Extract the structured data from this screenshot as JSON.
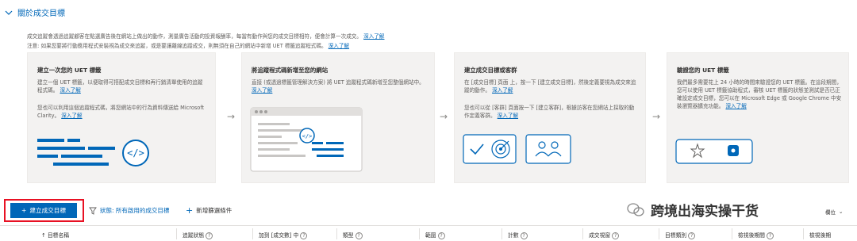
{
  "section": {
    "title": "關於成交目標",
    "desc_line1": "成交追蹤會透過追蹤顧客在點選廣告後在網站上做出的動作，測量廣告活動的投資報酬率，每當有動作與您的成交目標相符，便會計算一次成交。",
    "desc_line1_link": "深入了解",
    "desc_line2": "注意: 如果您要將行動應用程式安裝視為成交來追蹤，或是要讓離線追蹤成交，則無須在自己的網站中新增 UET 標籤追蹤程式碼。",
    "desc_line2_link": "深入了解"
  },
  "cards": [
    {
      "title": "建立一次您的 UET 標籤",
      "body1": "建立一個 UET 標籤，以便取得可搭配成交目標和再行銷清單使用的追蹤程式碼。",
      "body1_link": "深入了解",
      "body2": "您也可以利用這個追蹤程式碼，將您網站中的行為資料傳送給 Microsoft Clarity。",
      "body2_link": "深入了解"
    },
    {
      "title": "將追蹤程式碼新增至您的網站",
      "body1": "直接 (或透過標籤管理解決方案) 將 UET 追蹤程式碼新增至您整個網站中。",
      "body1_link": "深入了解"
    },
    {
      "title": "建立成交目標或客群",
      "body1": "在 [成交目標] 頁面 上，按一下 [建立成交目標]，然後定義要視為成交來追蹤的動作。",
      "body1_link": "深入了解",
      "body2": "您也可以從 [客群] 頁面按一下 [建立客群]，根據訪客在您網站上採取的動作定義客群。",
      "body2_link": "深入了解"
    },
    {
      "title": "驗證您的 UET 標籤",
      "body1": "我們最多需要花上 24 小時的時間來驗證您的 UET 標籤。在這段期間，您可以使用 UET 標籤協助程式，審核 UET 標籤的狀態並測試是否已正確設定成交目標，您可以在 Microsoft Edge 或 Google Chrome 中安裝瀏覽器擴充功能。",
      "body1_link": "深入了解"
    }
  ],
  "toolbar": {
    "create_label": "建立成交目標",
    "filter_label": "狀態: 所有啟用的成交目標",
    "add_filter_label": "新增篩選條件",
    "watermark": "跨境出海实操干货",
    "right_partial": "欄位"
  },
  "table": {
    "columns": [
      "目標名稱",
      "追蹤狀態",
      "加到 [成交數] 中",
      "類型",
      "範圍",
      "計數",
      "成交視窗",
      "目標類別",
      "檢視後期間",
      "檢視後期"
    ]
  },
  "colors": {
    "accent": "#0067b8",
    "highlight": "#e81123",
    "card_bg": "#f3f2f1"
  }
}
